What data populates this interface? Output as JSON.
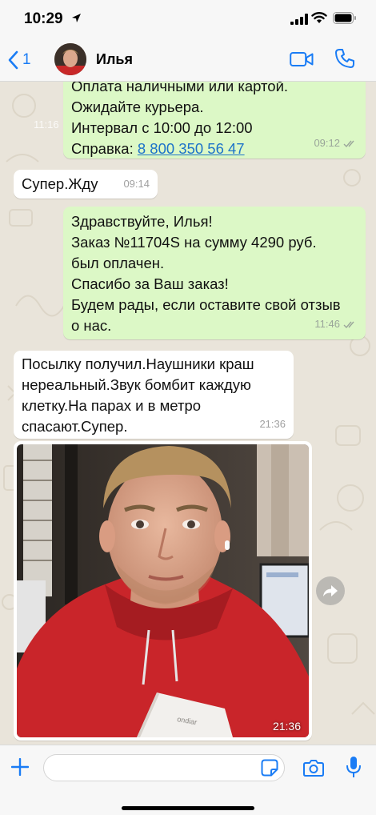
{
  "status_bar": {
    "time": "10:29"
  },
  "header": {
    "back_count": "1",
    "contact_name": "Илья"
  },
  "messages": [
    {
      "direction": "out",
      "lines": [
        "Оплата наличными или картой.",
        "Ожидайте курьера.",
        "Интервал с 10:00 до 12:00"
      ],
      "ref_label": "Справка: ",
      "ref_link": "8 800 350 56 47",
      "time": "09:12"
    },
    {
      "direction": "in",
      "lines": [
        "Супер.Жду"
      ],
      "time": "09:14"
    },
    {
      "direction": "out",
      "lines": [
        "Здравствуйте, Илья!",
        "Заказ №11704S на сумму 4290 руб.",
        "был оплачен.",
        "Спасибо за Ваш заказ!",
        "Будем рады, если оставите свой отзыв",
        "о нас."
      ],
      "time": "11:46"
    },
    {
      "direction": "in",
      "lines": [
        "Посылку получил.Наушники  краш",
        "нереальный.Звук бомбит каждую",
        "клетку.На парах и в метро",
        "спасают.Супер."
      ],
      "time": "21:36"
    }
  ],
  "background_time": "11:16",
  "photo_message": {
    "time": "21:36",
    "box_text": "ondiar"
  },
  "input": {
    "placeholder": ""
  },
  "colors": {
    "accent": "#1a7cf5",
    "outgoing_bubble": "#dcf8c6",
    "incoming_bubble": "#ffffff",
    "chat_background": "#e9e4da",
    "read_ticks": "#9aa59a"
  }
}
